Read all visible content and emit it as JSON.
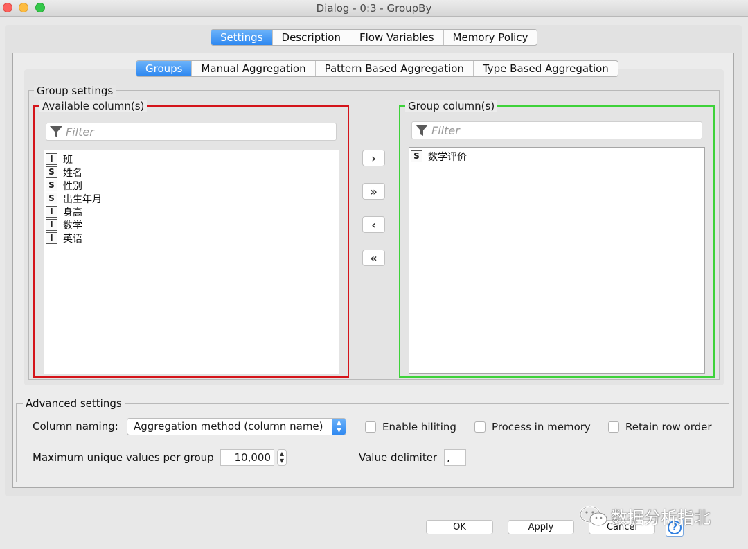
{
  "window": {
    "title": "Dialog - 0:3 - GroupBy"
  },
  "main_tabs": [
    "Settings",
    "Description",
    "Flow Variables",
    "Memory Policy"
  ],
  "sub_tabs": [
    "Groups",
    "Manual Aggregation",
    "Pattern Based Aggregation",
    "Type Based Aggregation"
  ],
  "group_settings": {
    "legend": "Group settings",
    "available": {
      "legend": "Available column(s)",
      "filter_placeholder": "Filter",
      "columns": [
        {
          "type": "I",
          "name": "班"
        },
        {
          "type": "S",
          "name": "姓名"
        },
        {
          "type": "S",
          "name": "性别"
        },
        {
          "type": "S",
          "name": "出生年月"
        },
        {
          "type": "I",
          "name": "身高"
        },
        {
          "type": "I",
          "name": "数学"
        },
        {
          "type": "I",
          "name": "英语"
        }
      ]
    },
    "group": {
      "legend": "Group column(s)",
      "filter_placeholder": "Filter",
      "columns": [
        {
          "type": "S",
          "name": "数学评价"
        }
      ]
    },
    "buttons": {
      "add": "›",
      "add_all": "»",
      "remove": "‹",
      "remove_all": "«"
    }
  },
  "advanced": {
    "legend": "Advanced settings",
    "column_naming_label": "Column naming:",
    "column_naming_value": "Aggregation method (column name)",
    "enable_hiliting": "Enable hiliting",
    "process_in_memory": "Process in memory",
    "retain_row_order": "Retain row order",
    "max_unique_label": "Maximum unique values per group",
    "max_unique_value": "10,000",
    "value_delimiter_label": "Value delimiter",
    "value_delimiter_value": ","
  },
  "footer": {
    "ok": "OK",
    "apply": "Apply",
    "cancel": "Cancel",
    "help": "?"
  },
  "watermark": "数据分析指北",
  "colors": {
    "available_border": "#d4141a",
    "group_border": "#3ed23a",
    "accent": "#2d87f0"
  }
}
